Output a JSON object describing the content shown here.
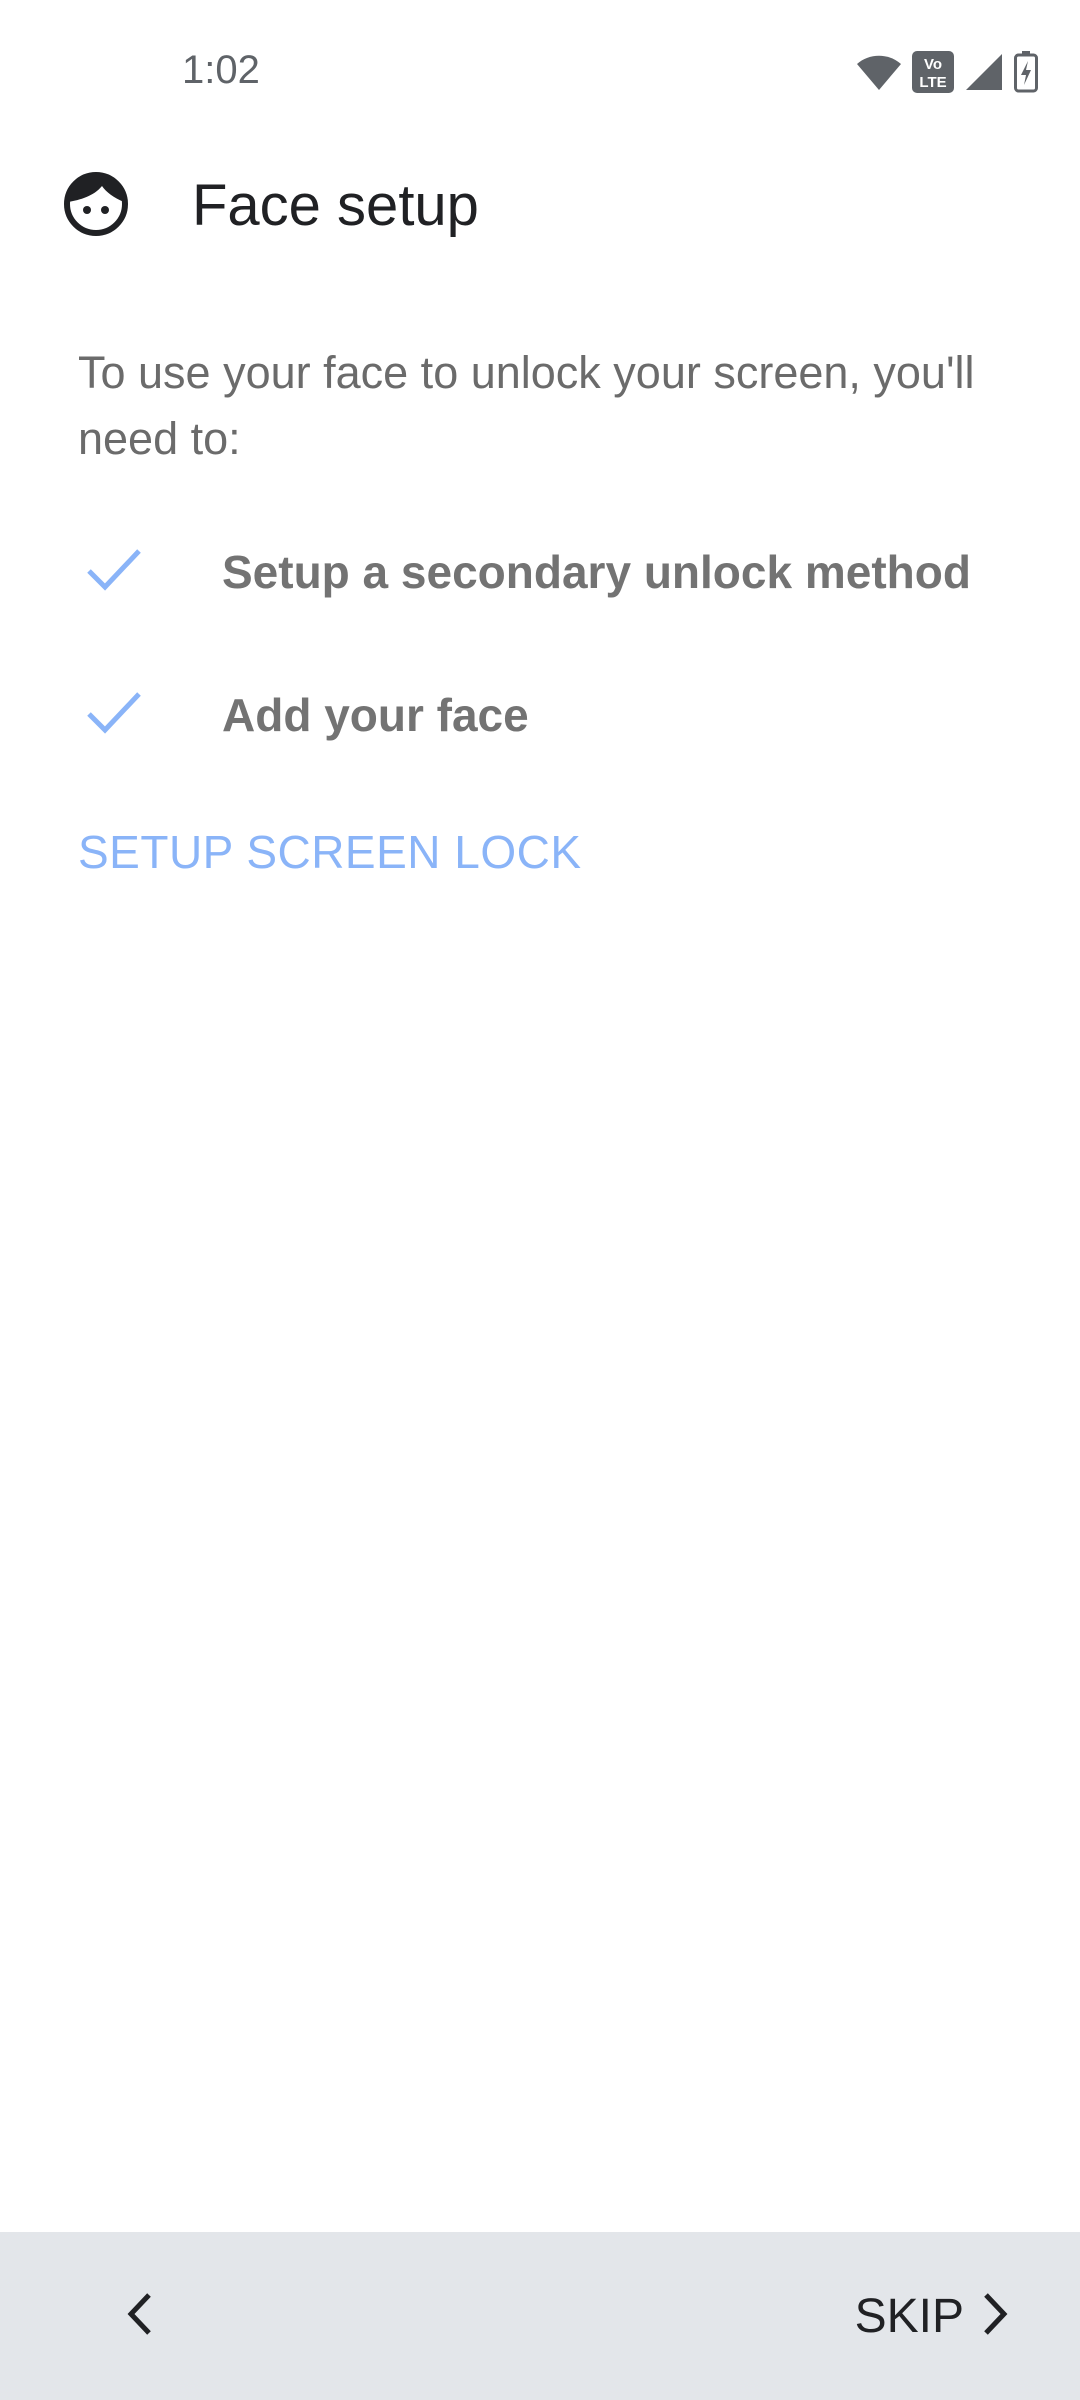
{
  "status_bar": {
    "time": "1:02",
    "icons": [
      "wifi-icon",
      "volte-icon",
      "signal-icon",
      "battery-charging-icon"
    ],
    "volte_top": "Vo",
    "volte_bottom": "LTE"
  },
  "header": {
    "icon": "face-icon",
    "title": "Face setup"
  },
  "intro_text": "To use your face to unlock your screen, you'll need to:",
  "requirements": [
    {
      "icon": "check-icon",
      "label": "Setup a secondary unlock method"
    },
    {
      "icon": "check-icon",
      "label": "Add your face"
    }
  ],
  "setup_link_label": "SETUP SCREEN LOCK",
  "footer": {
    "back_icon": "chevron-left-icon",
    "skip_label": "SKIP",
    "skip_icon": "chevron-right-icon"
  },
  "colors": {
    "accent": "#8ab4f8",
    "footer_bg": "#e3e6ea",
    "muted_text": "#6b6b6b"
  }
}
